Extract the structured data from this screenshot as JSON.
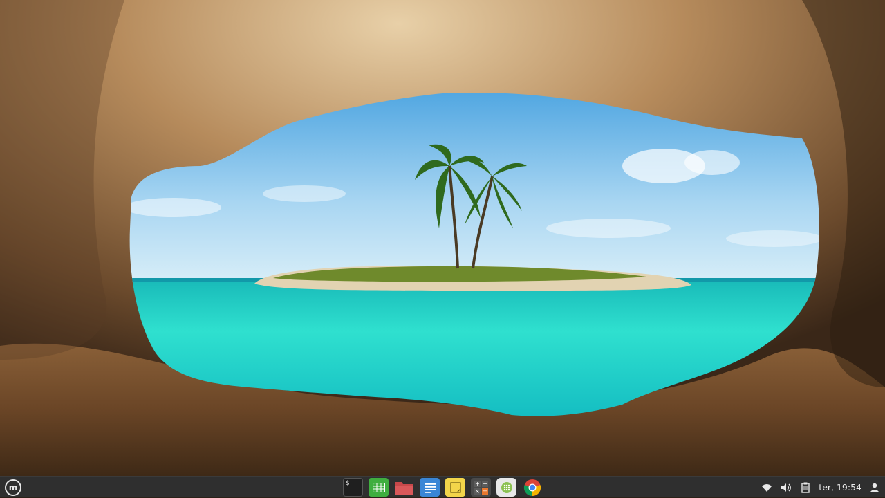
{
  "desktop": {
    "wallpaper": "tropical-island-cave-wallpaper"
  },
  "panel": {
    "menu_icon": "linux-mint-logo",
    "menu_glyph": "m",
    "launchers": [
      {
        "icon": "terminal-icon",
        "color": "#2b2b2b",
        "glyph": "$_"
      },
      {
        "icon": "spreadsheet-icon",
        "color": "#3fae3f"
      },
      {
        "icon": "folder-icon",
        "color": "#c7484a"
      },
      {
        "icon": "text-editor-icon",
        "color": "#3a86d6"
      },
      {
        "icon": "sticky-notes-icon",
        "color": "#f2d54a"
      },
      {
        "icon": "calculator-icon",
        "color": "#4a4a4a"
      },
      {
        "icon": "software-manager-icon",
        "color": "#8cc152"
      },
      {
        "icon": "chrome-icon",
        "color": "#db4437"
      }
    ],
    "tray": {
      "icons": [
        "wifi-icon",
        "volume-icon",
        "clipboard-icon",
        "user-icon"
      ],
      "clock": "ter, 19:54"
    }
  }
}
